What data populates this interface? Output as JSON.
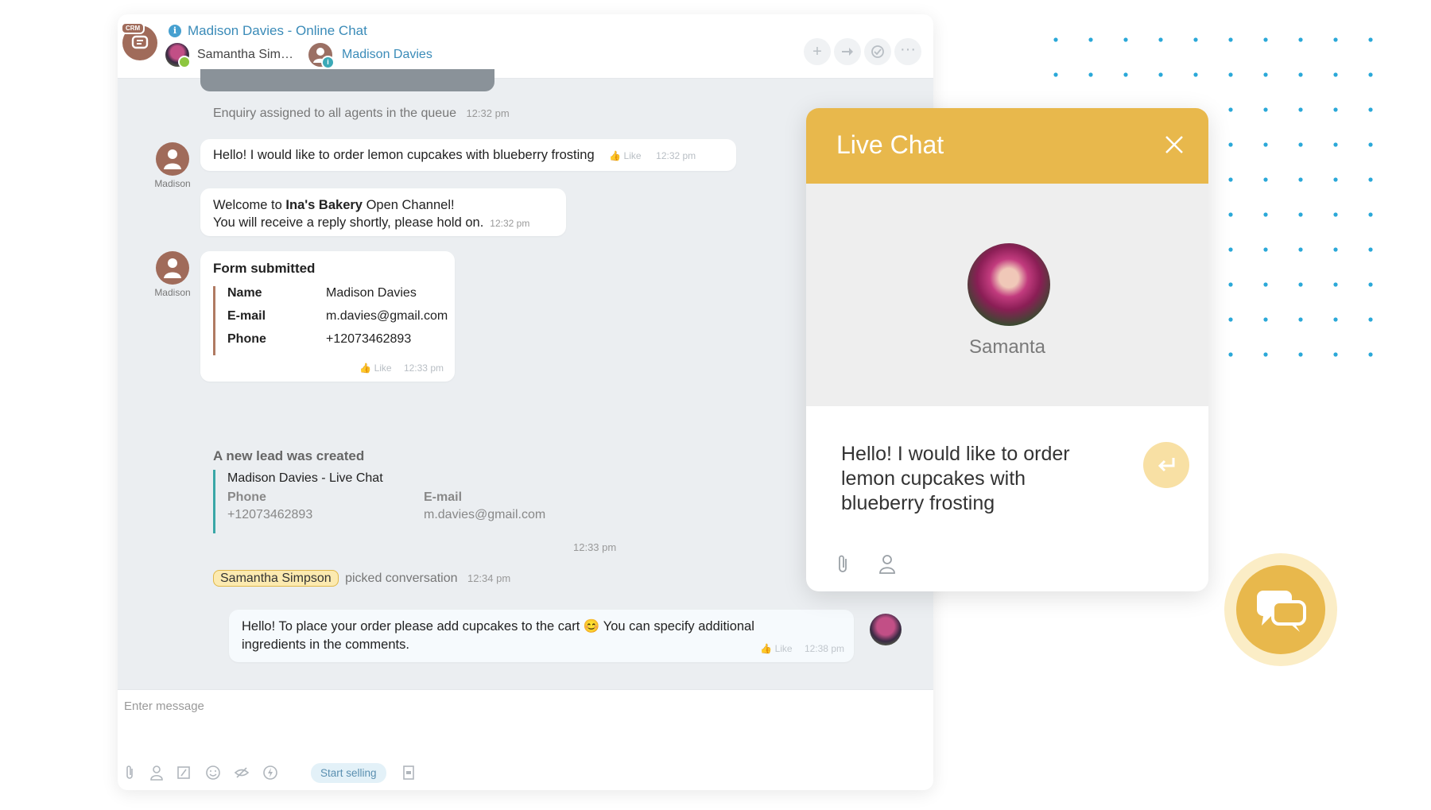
{
  "header": {
    "title": "Madison Davies - Online Chat",
    "crm_badge": "CRM",
    "participant_1": "Samantha Sim…",
    "participant_2": "Madison Davies"
  },
  "messages": {
    "system_assigned": {
      "text": "Enquiry assigned to all agents in the queue",
      "time": "12:32 pm"
    },
    "customer_msg": {
      "author": "Madison",
      "text": "Hello! I would like to order lemon cupcakes with blueberry frosting",
      "like": "Like",
      "time": "12:32 pm"
    },
    "welcome": {
      "line1_prefix": "Welcome to ",
      "line1_bold": "Ina's Bakery",
      "line1_suffix": " Open Channel!",
      "line2": "You will receive a reply shortly, please hold on.",
      "time": "12:32 pm"
    },
    "form": {
      "author": "Madison",
      "title": "Form submitted",
      "rows": [
        {
          "label": "Name",
          "value": "Madison Davies"
        },
        {
          "label": "E-mail",
          "value": "m.davies@gmail.com"
        },
        {
          "label": "Phone",
          "value": "+12073462893"
        }
      ],
      "like": "Like",
      "time": "12:33 pm"
    },
    "lead": {
      "title": "A new lead was created",
      "name": "Madison Davies - Live Chat",
      "phone_label": "Phone",
      "phone": "+12073462893",
      "email_label": "E-mail",
      "email": "m.davies@gmail.com",
      "time": "12:33 pm"
    },
    "picked": {
      "agent": "Samantha Simpson",
      "text": "picked conversation",
      "time": "12:34 pm"
    },
    "agent_reply": {
      "text_a": "Hello! To place your order please add cupcakes to the cart ",
      "emoji": "😊",
      "text_b": " You can specify additional",
      "text_c": "ingredients in the comments.",
      "like": "Like",
      "time": "12:38 pm"
    }
  },
  "input": {
    "placeholder": "Enter message",
    "start_selling": "Start selling"
  },
  "widget": {
    "title": "Live Chat",
    "agent_name": "Samanta",
    "message": "Hello! I would like to order lemon cupcakes with blueberry frosting"
  },
  "colors": {
    "accent_yellow": "#e8b84c",
    "link_blue": "#3a8bb8",
    "lead_teal": "#3aa7a7",
    "dots_blue": "#2aa8d8"
  }
}
